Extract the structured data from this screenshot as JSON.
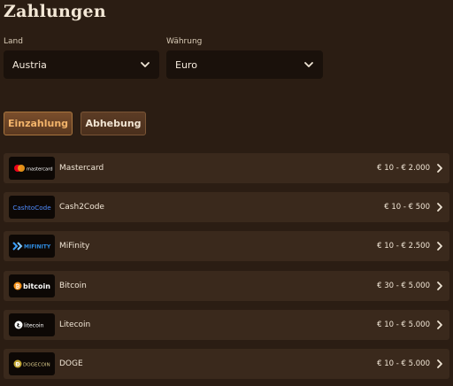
{
  "page": {
    "title": "Zahlungen"
  },
  "filters": {
    "country_label": "Land",
    "country_value": "Austria",
    "currency_label": "Währung",
    "currency_value": "Euro"
  },
  "tabs": [
    {
      "label": "Einzahlung",
      "active": true
    },
    {
      "label": "Abhebung",
      "active": false
    }
  ],
  "methods": [
    {
      "name": "Mastercard",
      "limit": "€ 10 - € 2.000",
      "logo_text": "mastercard"
    },
    {
      "name": "Cash2Code",
      "limit": "€ 10 - € 500",
      "logo_text": "CashtoCode"
    },
    {
      "name": "MiFinity",
      "limit": "€ 10 - € 2.500",
      "logo_text": "MIFINITY"
    },
    {
      "name": "Bitcoin",
      "limit": "€ 30 - € 5.000",
      "logo_text": "bitcoin"
    },
    {
      "name": "Litecoin",
      "limit": "€ 10 - € 5.000",
      "logo_text": "litecoin"
    },
    {
      "name": "DOGE",
      "limit": "€ 10 - € 5.000",
      "logo_text": "DOGECOIN"
    }
  ],
  "colors": {
    "background": "#2b1d13",
    "row": "#3a291c",
    "select": "#1a110b",
    "accent": "#f2b36a"
  }
}
